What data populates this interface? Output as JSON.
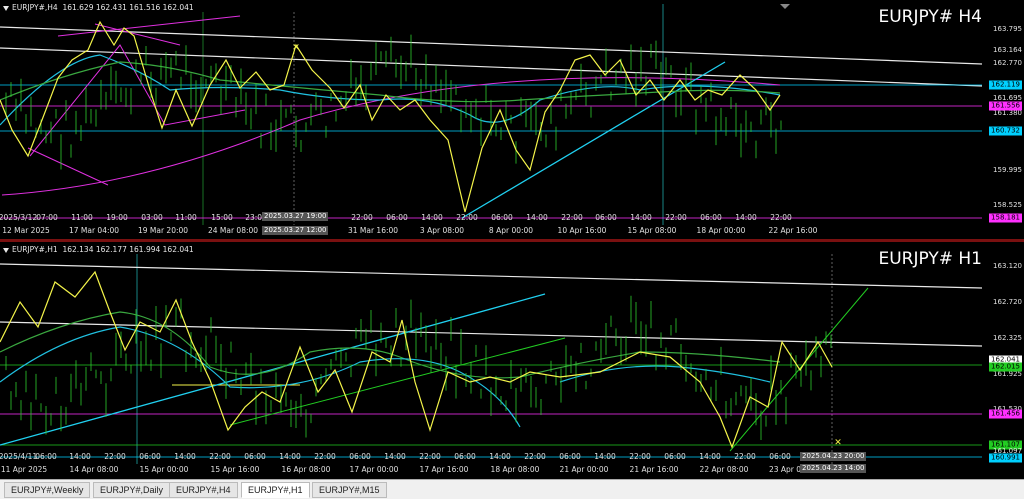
{
  "chart_top": {
    "symbol": "EURJPY#,H4",
    "ohlc": "161.629 162.431 161.516 162.041",
    "big_label": "EURJPY#  H4",
    "price_labels": [
      "163.795",
      "163.164",
      "162.770",
      "161.695",
      "161.380",
      "160.732",
      "159.995",
      "158.525"
    ],
    "marker_labels": [
      {
        "text": "162.119",
        "color": "#00d0ff",
        "fg": "#000"
      },
      {
        "text": "161.556",
        "color": "#ff30ff",
        "fg": "#000"
      },
      {
        "text": "160.732",
        "color": "#00d0ff",
        "fg": "#000"
      },
      {
        "text": "158.181",
        "color": "#ff30ff",
        "fg": "#000"
      }
    ],
    "time_labels": [
      "2025/3/12",
      "07:00",
      "11:00",
      "19:00",
      "03:00",
      "11:00",
      "15:00",
      "23:00",
      "2025.03.27 19:00",
      "22:00",
      "06:00",
      "14:00",
      "22:00",
      "06:00",
      "14:00",
      "22:00",
      "06:00",
      "14:00",
      "22:00",
      "06:00",
      "14:00",
      "22:00"
    ],
    "date_labels": [
      "12 Mar 2025",
      "17 Mar 04:00",
      "19 Mar 20:00",
      "24 Mar 08:00",
      "2025.03.27 12:00",
      "31 Mar 16:00",
      "3 Apr 08:00",
      "8 Apr 00:00",
      "10 Apr 16:00",
      "15 Apr 08:00",
      "18 Apr 00:00",
      "22 Apr 16:00"
    ]
  },
  "chart_bottom": {
    "symbol": "EURJPY#,H1",
    "ohlc": "162.134 162.177 161.994 162.041",
    "big_label": "EURJPY#  H1",
    "price_labels": [
      "163.120",
      "162.720",
      "162.325",
      "161.925",
      "161.530",
      "161.097"
    ],
    "marker_labels": [
      {
        "text": "162.041",
        "color": "#ffffff",
        "fg": "#000"
      },
      {
        "text": "162.015",
        "color": "#22cc22",
        "fg": "#000"
      },
      {
        "text": "161.456",
        "color": "#ff30ff",
        "fg": "#000"
      },
      {
        "text": "161.107",
        "color": "#22cc22",
        "fg": "#000"
      },
      {
        "text": "160.991",
        "color": "#00d0ff",
        "fg": "#000"
      }
    ],
    "time_labels": [
      "2025/4/11",
      "06:00",
      "14:00",
      "22:00",
      "06:00",
      "14:00",
      "22:00",
      "06:00",
      "14:00",
      "22:00",
      "06:00",
      "14:00",
      "22:00",
      "06:00",
      "14:00",
      "22:00",
      "06:00",
      "14:00",
      "22:00",
      "06:00",
      "14:00",
      "22:00",
      "06:00"
    ],
    "date_labels": [
      "11 Apr 2025",
      "14 Apr 08:00",
      "15 Apr 00:00",
      "15 Apr 16:00",
      "16 Apr 08:00",
      "17 Apr 00:00",
      "17 Apr 16:00",
      "18 Apr 08:00",
      "21 Apr 00:00",
      "21 Apr 16:00",
      "22 Apr 08:00",
      "23 Apr 0"
    ],
    "cursor_time_1": "2025.04.23 20:00",
    "cursor_time_2": "2025.04.23 14:00"
  },
  "tabs": [
    "EURJPY#,Weekly",
    "EURJPY#,Daily",
    "EURJPY#,H4",
    "EURJPY#,H1",
    "EURJPY#,M15"
  ],
  "active_tab": "EURJPY#,H1"
}
